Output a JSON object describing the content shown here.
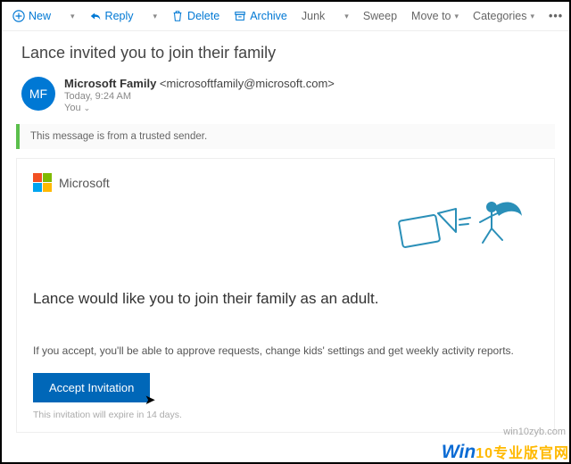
{
  "toolbar": {
    "new": "New",
    "reply": "Reply",
    "delete": "Delete",
    "archive": "Archive",
    "junk": "Junk",
    "sweep": "Sweep",
    "move": "Move to",
    "categories": "Categories"
  },
  "subject": "Lance invited you to join their family",
  "sender": {
    "initials": "MF",
    "name": "Microsoft Family",
    "address": "<microsoftfamily@microsoft.com>",
    "datetime": "Today, 9:24 AM",
    "recipient": "You"
  },
  "trusted_banner": "This message is from a trusted sender.",
  "card": {
    "brand": "Microsoft",
    "title": "Lance would like you to join their family as an adult.",
    "body": "If you accept, you'll be able to approve requests, change kids' settings and get weekly activity reports.",
    "accept_label": "Accept Invitation",
    "expiry": "This invitation will expire in 14 days."
  },
  "watermark": {
    "url": "win10zyb.com",
    "prefix": "Win",
    "suffix": "10专业版官网"
  }
}
